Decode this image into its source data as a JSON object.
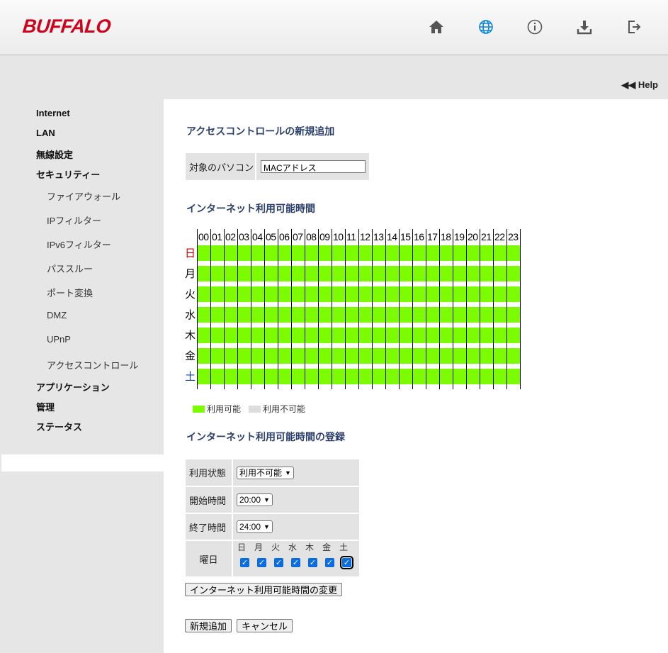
{
  "header": {
    "logo": "BUFFALO",
    "icons": [
      "home-icon",
      "globe-icon",
      "info-icon",
      "download-icon",
      "logout-icon"
    ],
    "help_label": "Help"
  },
  "sidebar": {
    "items": [
      {
        "label": "Internet",
        "level": 1
      },
      {
        "label": "LAN",
        "level": 1
      },
      {
        "label": "無線設定",
        "level": 1
      },
      {
        "label": "セキュリティー",
        "level": 1
      },
      {
        "label": "ファイアウォール",
        "level": 2
      },
      {
        "label": "IPフィルター",
        "level": 2
      },
      {
        "label": "IPv6フィルター",
        "level": 2
      },
      {
        "label": "パススルー",
        "level": 2
      },
      {
        "label": "ポート変換",
        "level": 2
      },
      {
        "label": "DMZ",
        "level": 2
      },
      {
        "label": "UPnP",
        "level": 2
      },
      {
        "label": "アクセスコントロール",
        "level": 2,
        "active": true
      },
      {
        "label": "アプリケーション",
        "level": 1
      },
      {
        "label": "管理",
        "level": 1
      },
      {
        "label": "ステータス",
        "level": 1
      }
    ]
  },
  "main": {
    "title": "アクセスコントロールの新規追加",
    "target": {
      "label": "対象のパソコン",
      "value": "MACアドレス"
    },
    "schedule_title": "インターネット利用可能時間",
    "hours": [
      "00",
      "01",
      "02",
      "03",
      "04",
      "05",
      "06",
      "07",
      "08",
      "09",
      "10",
      "11",
      "12",
      "13",
      "14",
      "15",
      "16",
      "17",
      "18",
      "19",
      "20",
      "21",
      "22",
      "23"
    ],
    "days": [
      {
        "label": "日",
        "color": "#cc0000"
      },
      {
        "label": "月",
        "color": "#000000"
      },
      {
        "label": "火",
        "color": "#000000"
      },
      {
        "label": "水",
        "color": "#000000"
      },
      {
        "label": "木",
        "color": "#000000"
      },
      {
        "label": "金",
        "color": "#000000"
      },
      {
        "label": "土",
        "color": "#1a3fa0"
      }
    ],
    "available_color": "#7cfc00",
    "unavailable_color": "#dddddd",
    "legend": {
      "available": "利用可能",
      "unavailable": "利用不可能"
    },
    "register_title": "インターネット利用可能時間の登録",
    "form": {
      "status_label": "利用状態",
      "status_value": "利用不可能",
      "start_label": "開始時間",
      "start_value": "20:00",
      "end_label": "終了時間",
      "end_value": "24:00",
      "weekday_label": "曜日",
      "weekdays": [
        "日",
        "月",
        "火",
        "水",
        "木",
        "金",
        "土"
      ],
      "weekday_checked": [
        true,
        true,
        true,
        true,
        true,
        true,
        true
      ]
    },
    "change_button": "インターネット利用可能時間の変更",
    "add_button": "新規追加",
    "cancel_button": "キャンセル"
  }
}
